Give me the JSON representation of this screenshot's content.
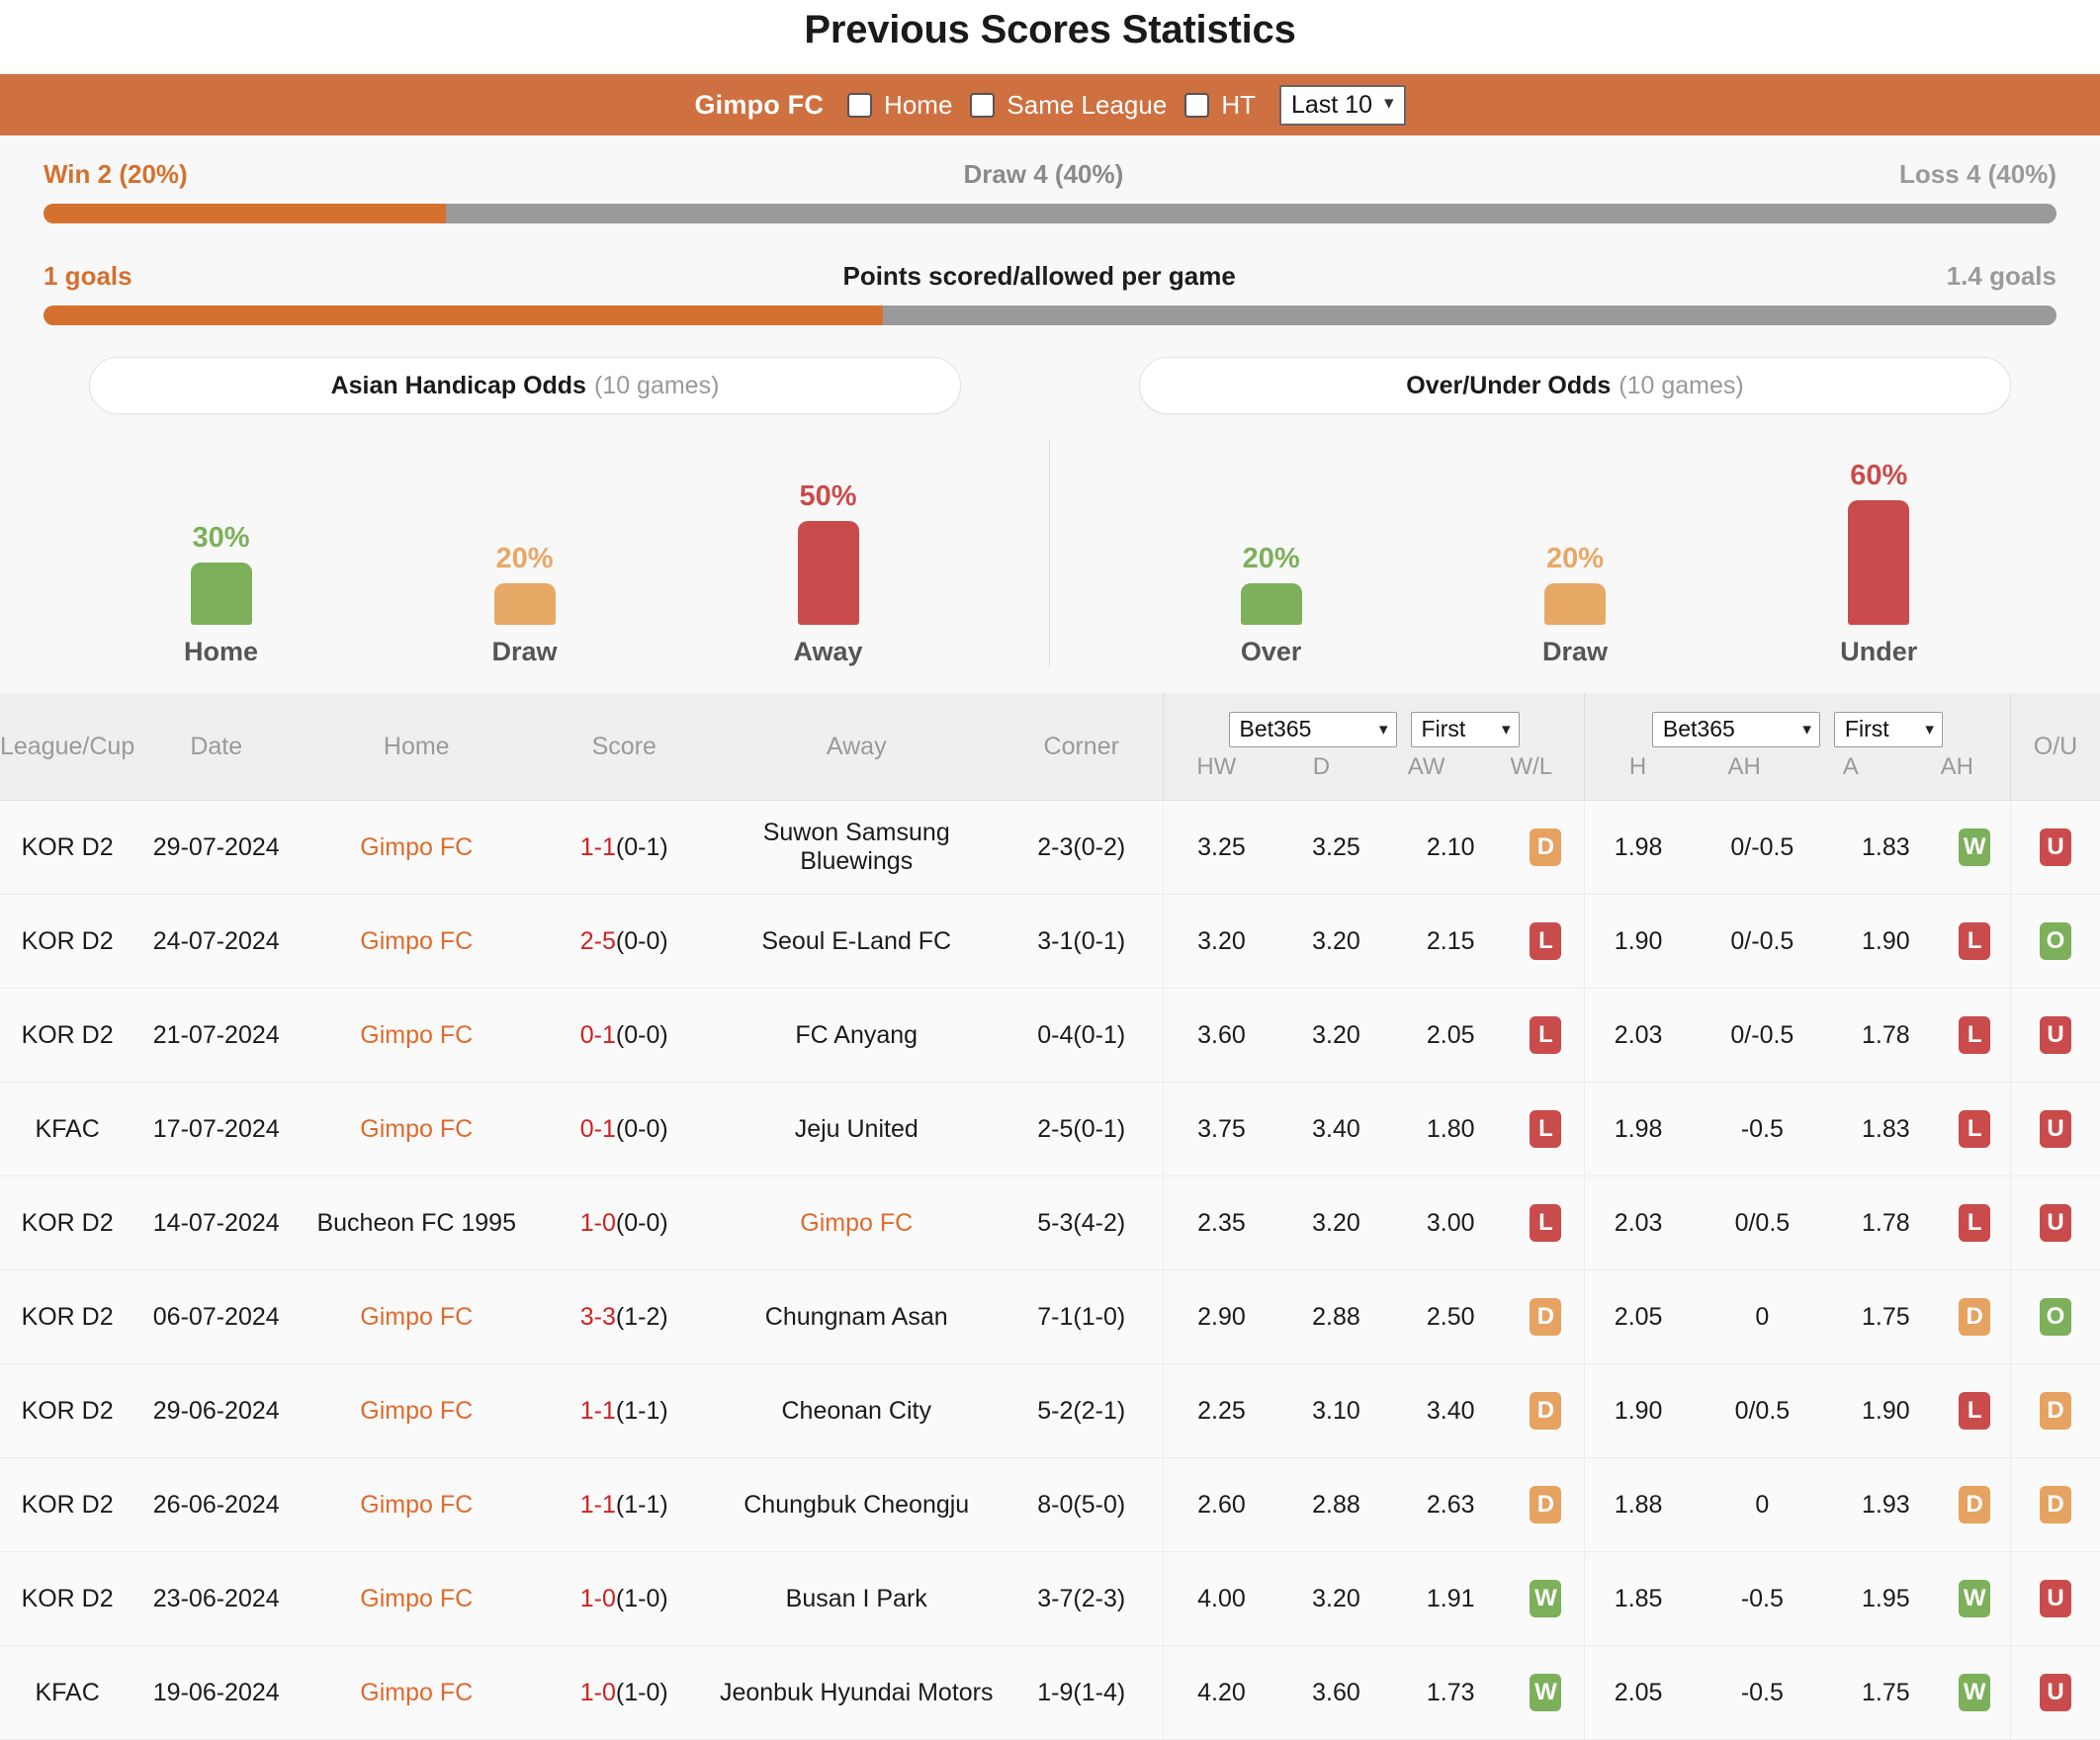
{
  "page_title": "Previous Scores Statistics",
  "filter": {
    "team": "Gimpo FC",
    "options": [
      {
        "label": "Home",
        "checked": false
      },
      {
        "label": "Same League",
        "checked": false
      },
      {
        "label": "HT",
        "checked": false
      }
    ],
    "range_select": "Last 10",
    "caret": "chevron-down"
  },
  "summary": {
    "record": {
      "win": "Win 2 (20%)",
      "draw": "Draw 4 (40%)",
      "loss": "Loss 4 (40%)",
      "win_pct": 20
    },
    "goals": {
      "scored": "1 goals",
      "title": "Points scored/allowed per game",
      "allowed": "1.4 goals",
      "scored_pct": 41.7
    }
  },
  "odds_tabs": [
    {
      "title": "Asian Handicap Odds",
      "games": "(10 games)"
    },
    {
      "title": "Over/Under Odds",
      "games": "(10 games)"
    }
  ],
  "chart_data": [
    {
      "type": "bar",
      "title": "Asian Handicap Odds (10 games)",
      "categories": [
        "Home",
        "Draw",
        "Away"
      ],
      "values": [
        30,
        20,
        50
      ],
      "labels": [
        "30%",
        "20%",
        "50%"
      ],
      "colors": [
        "#7cb05b",
        "#e8a865",
        "#ca4b4b"
      ],
      "ylabel": "percent",
      "ylim": [
        0,
        100
      ],
      "grid": false,
      "legend": "none"
    },
    {
      "type": "bar",
      "title": "Over/Under Odds (10 games)",
      "categories": [
        "Over",
        "Draw",
        "Under"
      ],
      "values": [
        20,
        20,
        60
      ],
      "labels": [
        "20%",
        "20%",
        "60%"
      ],
      "colors": [
        "#7cb05b",
        "#e8a865",
        "#ca4b4b"
      ],
      "ylabel": "percent",
      "ylim": [
        0,
        100
      ],
      "grid": false,
      "legend": "none"
    }
  ],
  "table": {
    "columns": [
      "League/Cup",
      "Date",
      "Home",
      "Score",
      "Away",
      "Corner"
    ],
    "ah_group": {
      "bookie": "Bet365",
      "period": "First",
      "sub": [
        "HW",
        "D",
        "AW",
        "W/L"
      ]
    },
    "ou_group": {
      "bookie": "Bet365",
      "period": "First",
      "sub": [
        "H",
        "AH",
        "A",
        "AH"
      ]
    },
    "ou_col": "O/U",
    "rows": [
      {
        "league": "KOR D2",
        "date": "29-07-2024",
        "home": "Gimpo FC",
        "home_hl": true,
        "score_main": "1-1",
        "score_ht": "(0-1)",
        "away": "Suwon Samsung Bluewings",
        "away_hl": false,
        "corner": "2-3(0-2)",
        "hw": "3.25",
        "d": "3.25",
        "aw": "2.10",
        "wl": "D",
        "h": "1.98",
        "ah1": "0/-0.5",
        "a": "1.83",
        "ah2": "W",
        "ou": "U"
      },
      {
        "league": "KOR D2",
        "date": "24-07-2024",
        "home": "Gimpo FC",
        "home_hl": true,
        "score_main": "2-5",
        "score_ht": "(0-0)",
        "away": "Seoul E-Land FC",
        "away_hl": false,
        "corner": "3-1(0-1)",
        "hw": "3.20",
        "d": "3.20",
        "aw": "2.15",
        "wl": "L",
        "h": "1.90",
        "ah1": "0/-0.5",
        "a": "1.90",
        "ah2": "L",
        "ou": "O"
      },
      {
        "league": "KOR D2",
        "date": "21-07-2024",
        "home": "Gimpo FC",
        "home_hl": true,
        "score_main": "0-1",
        "score_ht": "(0-0)",
        "away": "FC Anyang",
        "away_hl": false,
        "corner": "0-4(0-1)",
        "hw": "3.60",
        "d": "3.20",
        "aw": "2.05",
        "wl": "L",
        "h": "2.03",
        "ah1": "0/-0.5",
        "a": "1.78",
        "ah2": "L",
        "ou": "U"
      },
      {
        "league": "KFAC",
        "date": "17-07-2024",
        "home": "Gimpo FC",
        "home_hl": true,
        "score_main": "0-1",
        "score_ht": "(0-0)",
        "away": "Jeju United",
        "away_hl": false,
        "corner": "2-5(0-1)",
        "hw": "3.75",
        "d": "3.40",
        "aw": "1.80",
        "wl": "L",
        "h": "1.98",
        "ah1": "-0.5",
        "a": "1.83",
        "ah2": "L",
        "ou": "U"
      },
      {
        "league": "KOR D2",
        "date": "14-07-2024",
        "home": "Bucheon FC 1995",
        "home_hl": false,
        "score_main": "1-0",
        "score_ht": "(0-0)",
        "away": "Gimpo FC",
        "away_hl": true,
        "corner": "5-3(4-2)",
        "hw": "2.35",
        "d": "3.20",
        "aw": "3.00",
        "wl": "L",
        "h": "2.03",
        "ah1": "0/0.5",
        "a": "1.78",
        "ah2": "L",
        "ou": "U"
      },
      {
        "league": "KOR D2",
        "date": "06-07-2024",
        "home": "Gimpo FC",
        "home_hl": true,
        "score_main": "3-3",
        "score_ht": "(1-2)",
        "away": "Chungnam Asan",
        "away_hl": false,
        "corner": "7-1(1-0)",
        "hw": "2.90",
        "d": "2.88",
        "aw": "2.50",
        "wl": "D",
        "h": "2.05",
        "ah1": "0",
        "a": "1.75",
        "ah2": "D",
        "ou": "O"
      },
      {
        "league": "KOR D2",
        "date": "29-06-2024",
        "home": "Gimpo FC",
        "home_hl": true,
        "score_main": "1-1",
        "score_ht": "(1-1)",
        "away": "Cheonan City",
        "away_hl": false,
        "corner": "5-2(2-1)",
        "hw": "2.25",
        "d": "3.10",
        "aw": "3.40",
        "wl": "D",
        "h": "1.90",
        "ah1": "0/0.5",
        "a": "1.90",
        "ah2": "L",
        "ou": "D"
      },
      {
        "league": "KOR D2",
        "date": "26-06-2024",
        "home": "Gimpo FC",
        "home_hl": true,
        "score_main": "1-1",
        "score_ht": "(1-1)",
        "away": "Chungbuk Cheongju",
        "away_hl": false,
        "corner": "8-0(5-0)",
        "hw": "2.60",
        "d": "2.88",
        "aw": "2.63",
        "wl": "D",
        "h": "1.88",
        "ah1": "0",
        "a": "1.93",
        "ah2": "D",
        "ou": "D"
      },
      {
        "league": "KOR D2",
        "date": "23-06-2024",
        "home": "Gimpo FC",
        "home_hl": true,
        "score_main": "1-0",
        "score_ht": "(1-0)",
        "away": "Busan I Park",
        "away_hl": false,
        "corner": "3-7(2-3)",
        "hw": "4.00",
        "d": "3.20",
        "aw": "1.91",
        "wl": "W",
        "h": "1.85",
        "ah1": "-0.5",
        "a": "1.95",
        "ah2": "W",
        "ou": "U"
      },
      {
        "league": "KFAC",
        "date": "19-06-2024",
        "home": "Gimpo FC",
        "home_hl": true,
        "score_main": "1-0",
        "score_ht": "(1-0)",
        "away": "Jeonbuk Hyundai Motors",
        "away_hl": false,
        "corner": "1-9(1-4)",
        "hw": "4.20",
        "d": "3.60",
        "aw": "1.73",
        "wl": "W",
        "h": "2.05",
        "ah1": "-0.5",
        "a": "1.75",
        "ah2": "W",
        "ou": "U"
      }
    ]
  },
  "colors": {
    "accent": "#cf7040",
    "win": "#7cb05b",
    "draw": "#e6a260",
    "loss": "#ca4b4b",
    "score": "#cf2222"
  }
}
